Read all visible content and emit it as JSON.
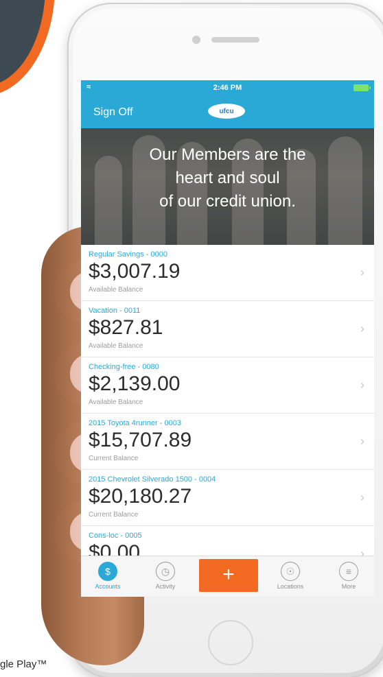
{
  "status_bar": {
    "time": "2:46 PM"
  },
  "nav": {
    "sign_off": "Sign Off",
    "logo_text": "ufcu"
  },
  "hero": {
    "lines": [
      "Our Members are the",
      "heart and soul",
      "of our credit union."
    ]
  },
  "accounts": [
    {
      "name": "Regular Savings - 0000",
      "amount": "$3,007.19",
      "label": "Available Balance"
    },
    {
      "name": "Vacation - 0011",
      "amount": "$827.81",
      "label": "Available Balance"
    },
    {
      "name": "Checking-free - 0080",
      "amount": "$2,139.00",
      "label": "Available Balance"
    },
    {
      "name": "2015 Toyota 4runner - 0003",
      "amount": "$15,707.89",
      "label": "Current Balance"
    },
    {
      "name": "2015 Chevrolet Silverado 1500 - 0004",
      "amount": "$20,180.27",
      "label": "Current Balance"
    },
    {
      "name": "Cons-loc - 0005",
      "amount": "$0.00",
      "label": ""
    }
  ],
  "tabs": {
    "accounts": "Accounts",
    "activity": "Activity",
    "locations": "Locations",
    "more": "More"
  },
  "page_footer": "gle Play™",
  "colors": {
    "brand_blue": "#2aa9d6",
    "accent_orange": "#f26a21"
  }
}
